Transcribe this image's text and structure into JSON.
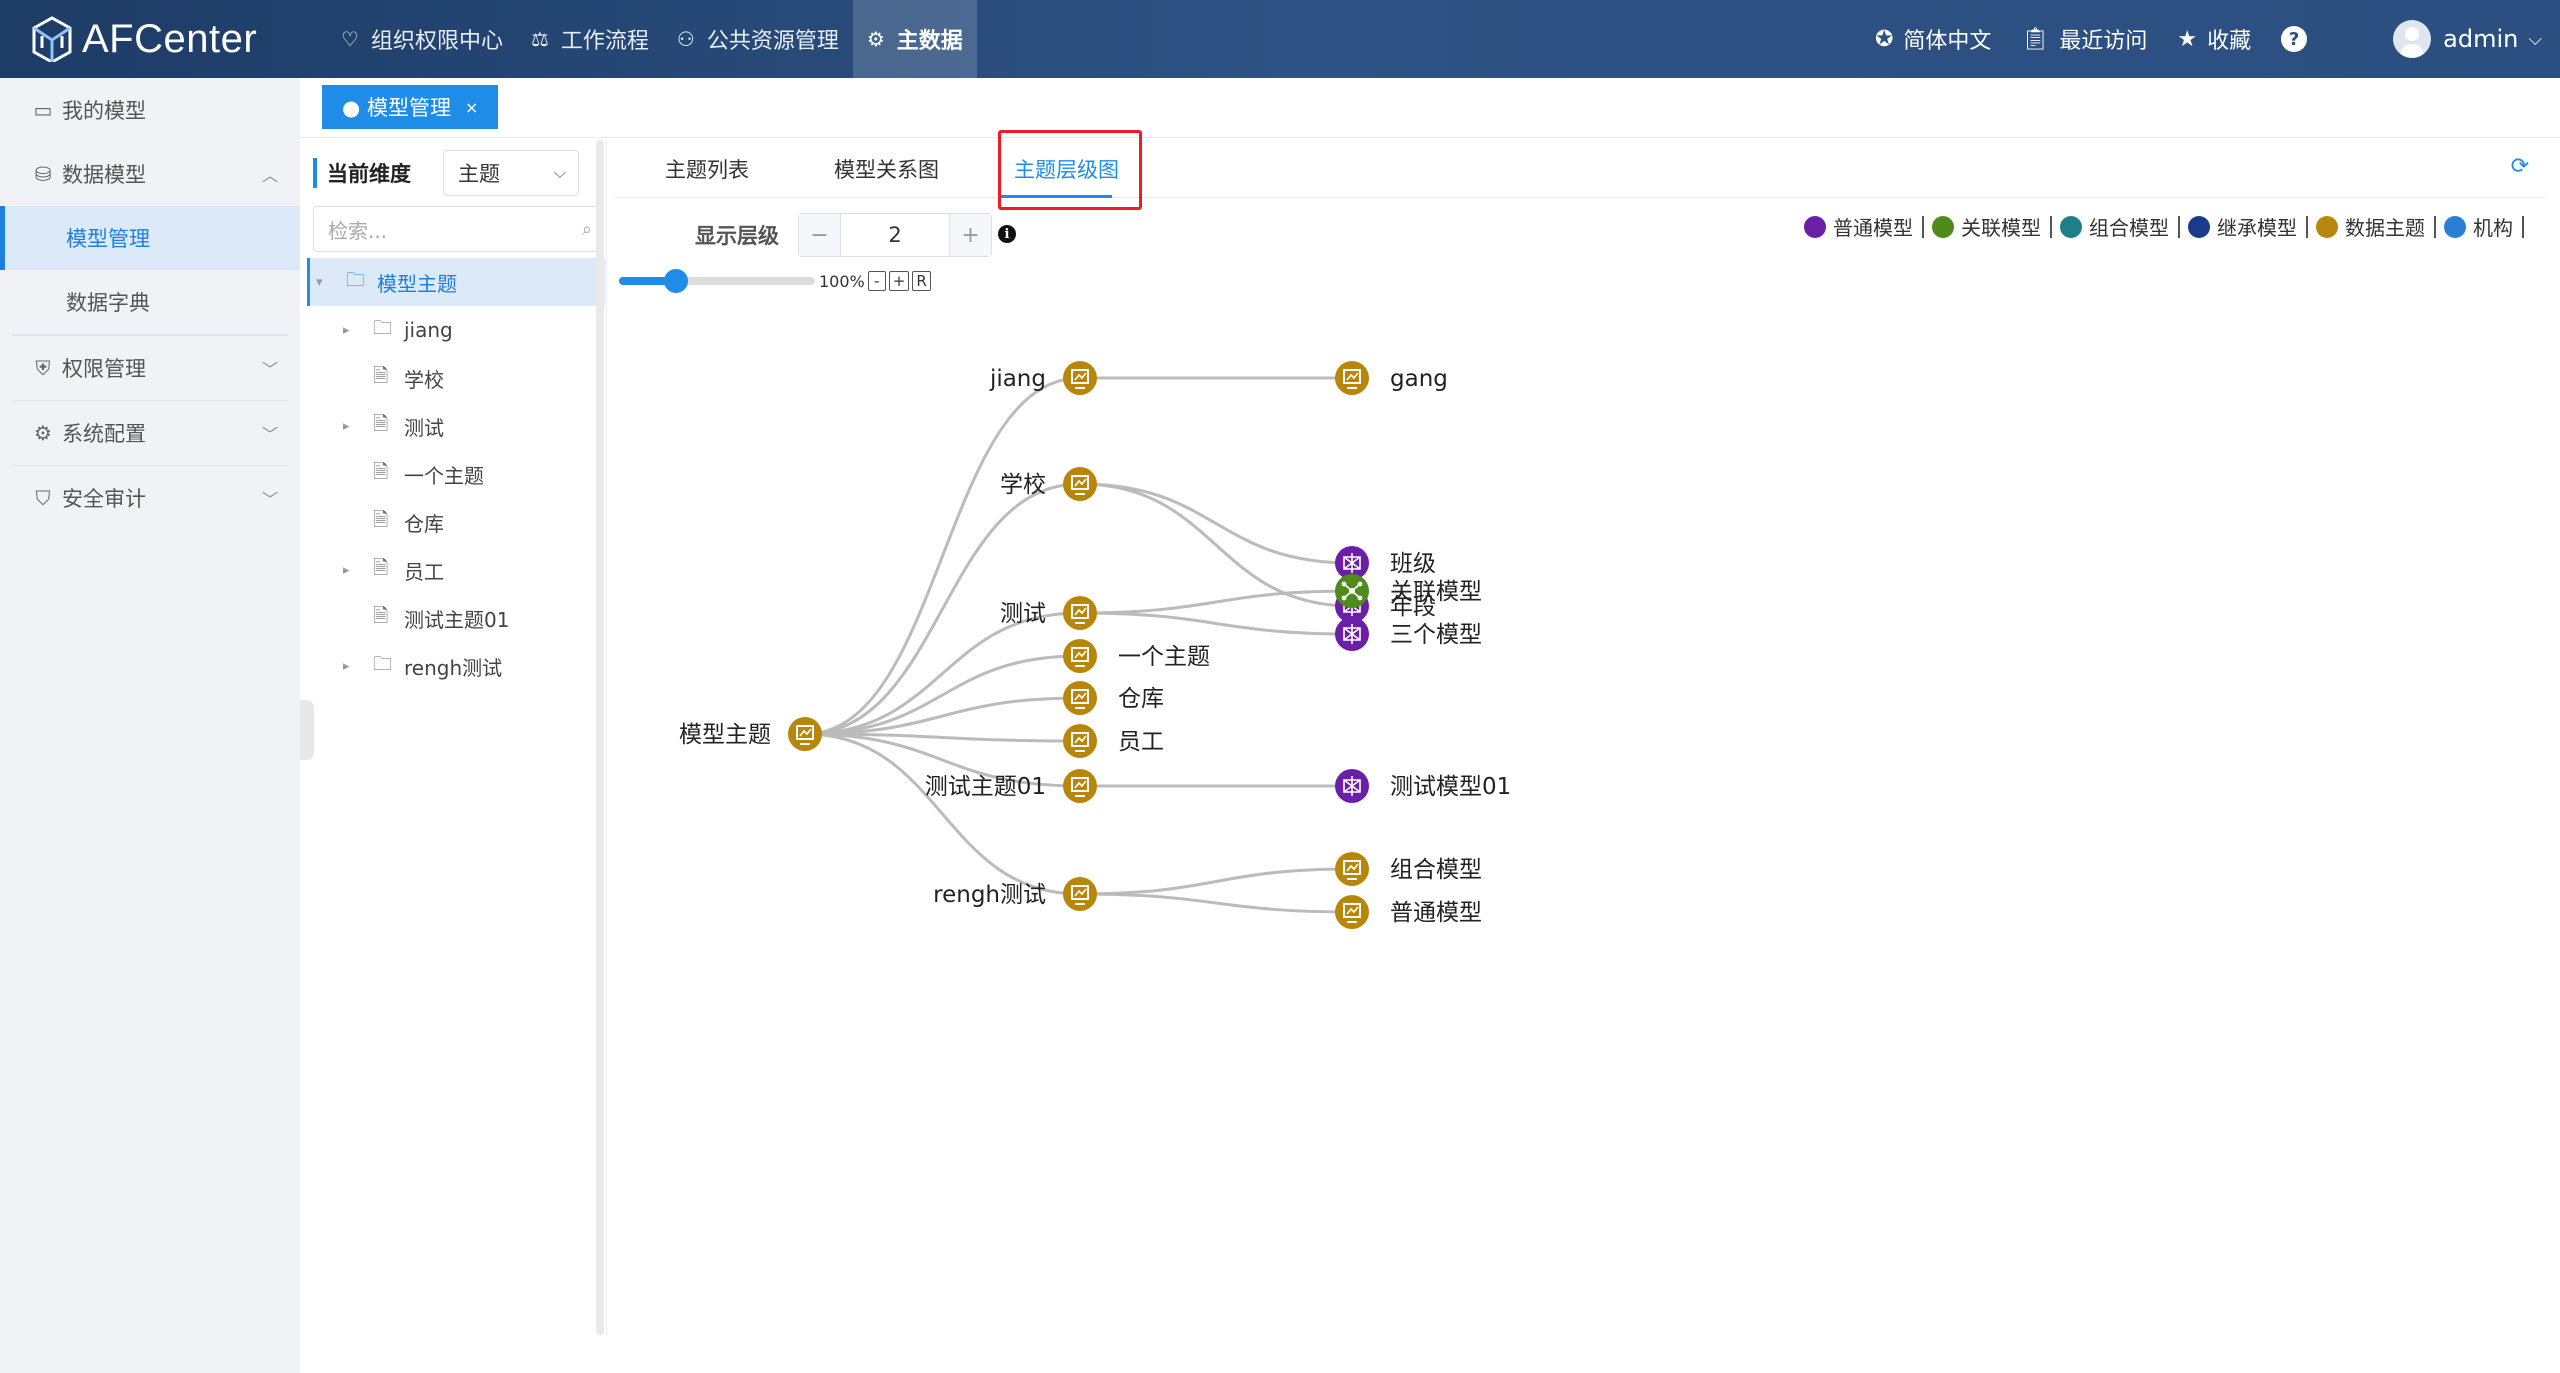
{
  "app": {
    "name": "AFCenter"
  },
  "topnav": [
    {
      "label": "组织权限中心",
      "icon": "heart-icon",
      "glyph": "♡"
    },
    {
      "label": "工作流程",
      "icon": "scale-icon",
      "glyph": "⚖"
    },
    {
      "label": "公共资源管理",
      "icon": "users-icon",
      "glyph": "⚇"
    },
    {
      "label": "主数据",
      "icon": "data-icon",
      "glyph": "⚙",
      "active": true
    }
  ],
  "topright": {
    "language": "简体中文",
    "recent": "最近访问",
    "favorites": "收藏",
    "help": "?",
    "user": "admin"
  },
  "sidebar": {
    "items": [
      {
        "label": "我的模型",
        "icon": "wallet-icon",
        "glyph": "▭"
      },
      {
        "label": "数据模型",
        "icon": "database-icon",
        "glyph": "⛁",
        "expanded": true
      },
      {
        "label": "模型管理",
        "sub": true,
        "active": true
      },
      {
        "label": "数据字典",
        "sub": true
      },
      {
        "label": "权限管理",
        "icon": "shield-icon",
        "glyph": "⛨"
      },
      {
        "label": "系统配置",
        "icon": "gear-icon",
        "glyph": "⚙"
      },
      {
        "label": "安全审计",
        "icon": "shield-check-icon",
        "glyph": "⛉"
      }
    ]
  },
  "page_tab": {
    "label": "● 模型管理",
    "close": "×"
  },
  "tree_panel": {
    "dimension_label": "当前维度",
    "dimension_value": "主题",
    "search_placeholder": "检索...",
    "nodes": [
      {
        "label": "模型主题",
        "level": 0,
        "expander": "▾",
        "icon": "folder",
        "selected": true
      },
      {
        "label": "jiang",
        "level": 1,
        "expander": "▸",
        "icon": "folder"
      },
      {
        "label": "学校",
        "level": 1,
        "expander": "",
        "icon": "doc"
      },
      {
        "label": "测试",
        "level": 1,
        "expander": "▸",
        "icon": "doc"
      },
      {
        "label": "一个主题",
        "level": 1,
        "expander": "",
        "icon": "doc"
      },
      {
        "label": "仓库",
        "level": 1,
        "expander": "",
        "icon": "doc"
      },
      {
        "label": "员工",
        "level": 1,
        "expander": "▸",
        "icon": "doc"
      },
      {
        "label": "测试主题01",
        "level": 1,
        "expander": "",
        "icon": "doc"
      },
      {
        "label": "rengh测试",
        "level": 1,
        "expander": "▸",
        "icon": "folder"
      }
    ]
  },
  "content_tabs": [
    {
      "label": "主题列表"
    },
    {
      "label": "模型关系图"
    },
    {
      "label": "主题层级图",
      "active": true
    }
  ],
  "toolbar": {
    "level_label": "显示层级",
    "level_value": "2",
    "minus": "−",
    "plus": "+",
    "info": "i"
  },
  "legend": [
    {
      "label": "普通模型",
      "color": "#6a1fa6",
      "icon": "normal-model-icon"
    },
    {
      "label": "关联模型",
      "color": "#4e8a1c",
      "icon": "related-model-icon"
    },
    {
      "label": "组合模型",
      "color": "#1e7f8a",
      "icon": "combined-model-icon"
    },
    {
      "label": "继承模型",
      "color": "#1a3a8c",
      "icon": "inherited-model-icon"
    },
    {
      "label": "数据主题",
      "color": "#b8860b",
      "icon": "data-topic-icon"
    },
    {
      "label": "机构",
      "color": "#2a7fd4",
      "icon": "org-icon"
    }
  ],
  "zoom": {
    "percent": "100%",
    "minus": "-",
    "plus": "+",
    "reset": "R",
    "level": 0.29
  },
  "graph": {
    "colors": {
      "topic": "#b8860b",
      "normal": "#6a1fa6",
      "related": "#4e8a1c",
      "edge": "#bbbbbb"
    },
    "root": {
      "label": "模型主题"
    },
    "children": [
      {
        "label": "jiang",
        "children": [
          {
            "label": "gang",
            "kind": "topic"
          }
        ]
      },
      {
        "label": "学校",
        "children": [
          {
            "label": "班级",
            "kind": "normal"
          },
          {
            "label": "年段",
            "kind": "normal"
          }
        ]
      },
      {
        "label": "测试",
        "children": [
          {
            "label": "关联模型",
            "kind": "related"
          },
          {
            "label": "三个模型",
            "kind": "normal"
          }
        ]
      },
      {
        "label": "一个主题",
        "children": []
      },
      {
        "label": "仓库",
        "children": []
      },
      {
        "label": "员工",
        "children": []
      },
      {
        "label": "测试主题01",
        "children": [
          {
            "label": "测试模型01",
            "kind": "normal"
          }
        ]
      },
      {
        "label": "rengh测试",
        "children": [
          {
            "label": "组合模型",
            "kind": "topic"
          },
          {
            "label": "普通模型",
            "kind": "topic"
          }
        ]
      }
    ]
  }
}
